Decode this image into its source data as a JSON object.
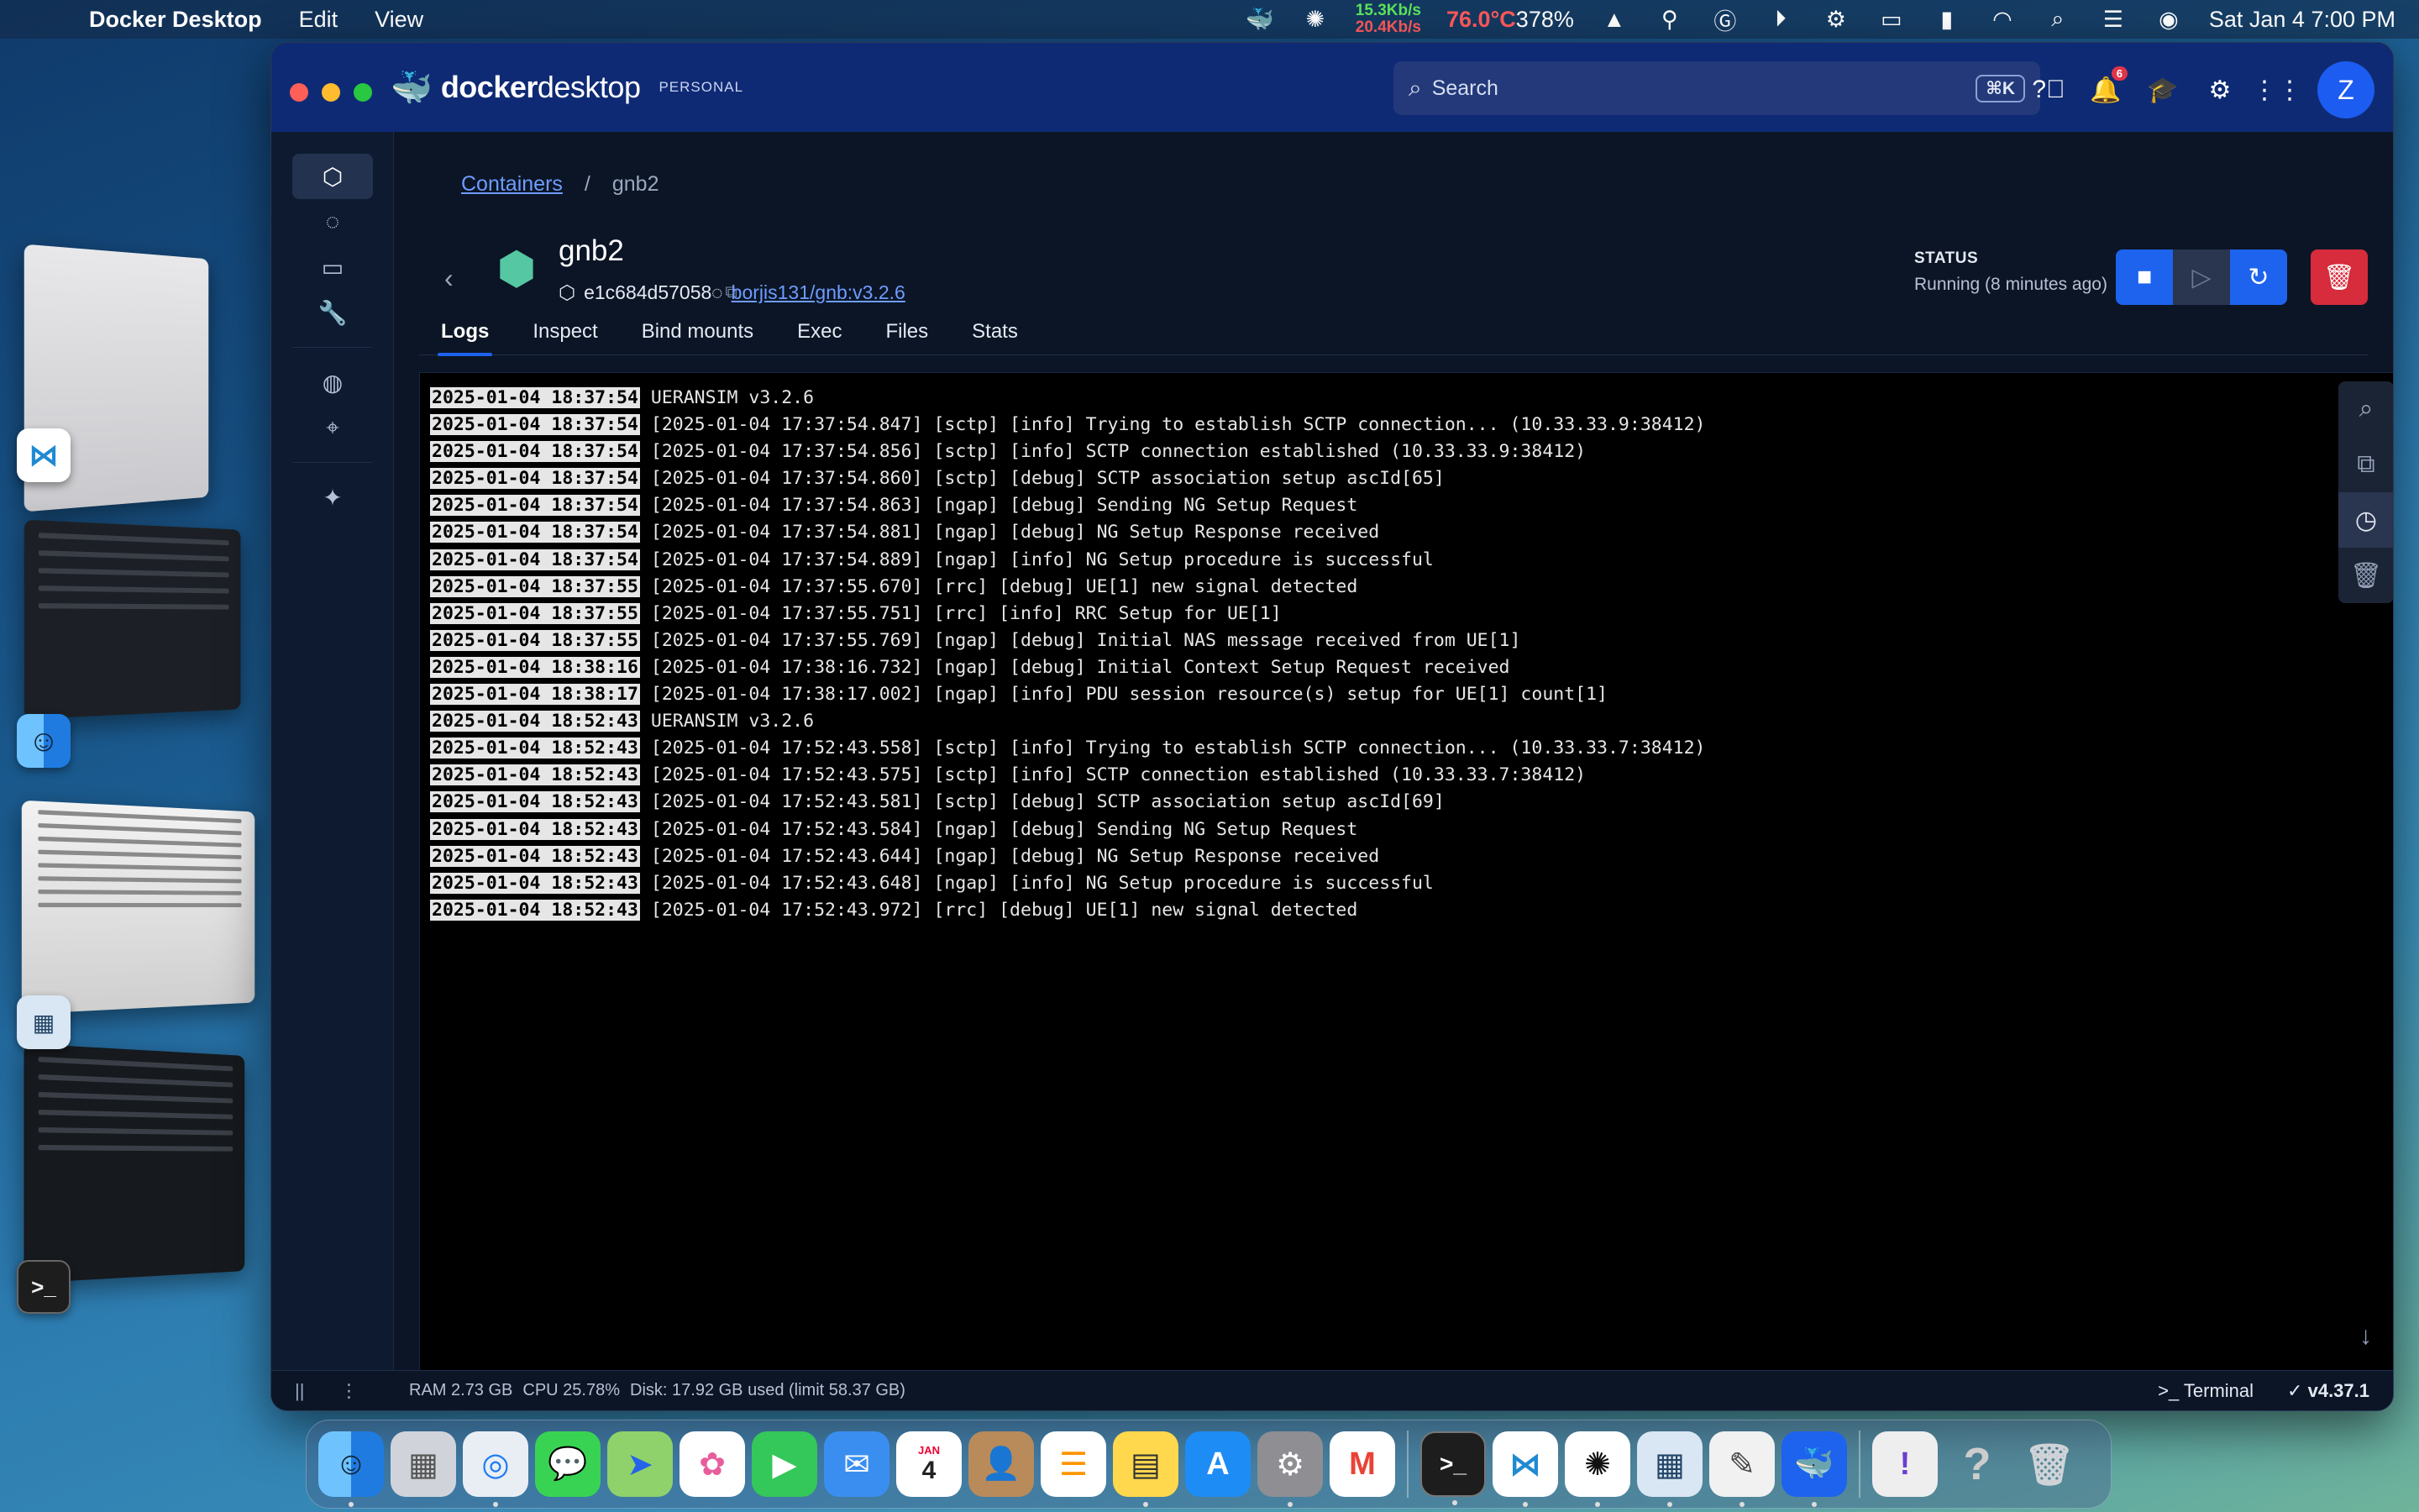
{
  "menubar": {
    "app_name": "Docker Desktop",
    "menus": [
      "Edit",
      "View"
    ],
    "net_up": "15.3Kb/s",
    "net_down": "20.4Kb/s",
    "temp": "76.0°C",
    "cpu": "378%",
    "datetime": "Sat Jan 4  7:00 PM"
  },
  "window": {
    "brand_docker": "docker",
    "brand_desktop": "desktop",
    "plan": "PERSONAL",
    "search_placeholder": "Search",
    "search_shortcut": "⌘K",
    "notification_count": "6",
    "avatar_initial": "Z"
  },
  "breadcrumb": {
    "root": "Containers",
    "separator": "/",
    "current": "gnb2"
  },
  "container": {
    "name": "gnb2",
    "id": "e1c684d57058",
    "image": "borjis131/gnb:v3.2.6",
    "status_label": "STATUS",
    "status_value": "Running (8 minutes ago)"
  },
  "tabs": [
    "Logs",
    "Inspect",
    "Bind mounts",
    "Exec",
    "Files",
    "Stats"
  ],
  "logs": [
    {
      "ts": "2025-01-04 18:37:54",
      "msg": "UERANSIM v3.2.6"
    },
    {
      "ts": "2025-01-04 18:37:54",
      "msg": "[2025-01-04 17:37:54.847] [sctp] [info] Trying to establish SCTP connection... (10.33.33.9:38412)"
    },
    {
      "ts": "2025-01-04 18:37:54",
      "msg": "[2025-01-04 17:37:54.856] [sctp] [info] SCTP connection established (10.33.33.9:38412)"
    },
    {
      "ts": "2025-01-04 18:37:54",
      "msg": "[2025-01-04 17:37:54.860] [sctp] [debug] SCTP association setup ascId[65]"
    },
    {
      "ts": "2025-01-04 18:37:54",
      "msg": "[2025-01-04 17:37:54.863] [ngap] [debug] Sending NG Setup Request"
    },
    {
      "ts": "2025-01-04 18:37:54",
      "msg": "[2025-01-04 17:37:54.881] [ngap] [debug] NG Setup Response received"
    },
    {
      "ts": "2025-01-04 18:37:54",
      "msg": "[2025-01-04 17:37:54.889] [ngap] [info] NG Setup procedure is successful"
    },
    {
      "ts": "2025-01-04 18:37:55",
      "msg": "[2025-01-04 17:37:55.670] [rrc] [debug] UE[1] new signal detected"
    },
    {
      "ts": "2025-01-04 18:37:55",
      "msg": "[2025-01-04 17:37:55.751] [rrc] [info] RRC Setup for UE[1]"
    },
    {
      "ts": "2025-01-04 18:37:55",
      "msg": "[2025-01-04 17:37:55.769] [ngap] [debug] Initial NAS message received from UE[1]"
    },
    {
      "ts": "2025-01-04 18:38:16",
      "msg": "[2025-01-04 17:38:16.732] [ngap] [debug] Initial Context Setup Request received"
    },
    {
      "ts": "2025-01-04 18:38:17",
      "msg": "[2025-01-04 17:38:17.002] [ngap] [info] PDU session resource(s) setup for UE[1] count[1]"
    },
    {
      "ts": "2025-01-04 18:52:43",
      "msg": "UERANSIM v3.2.6"
    },
    {
      "ts": "2025-01-04 18:52:43",
      "msg": "[2025-01-04 17:52:43.558] [sctp] [info] Trying to establish SCTP connection... (10.33.33.7:38412)"
    },
    {
      "ts": "2025-01-04 18:52:43",
      "msg": "[2025-01-04 17:52:43.575] [sctp] [info] SCTP connection established (10.33.33.7:38412)"
    },
    {
      "ts": "2025-01-04 18:52:43",
      "msg": "[2025-01-04 17:52:43.581] [sctp] [debug] SCTP association setup ascId[69]"
    },
    {
      "ts": "2025-01-04 18:52:43",
      "msg": "[2025-01-04 17:52:43.584] [ngap] [debug] Sending NG Setup Request"
    },
    {
      "ts": "2025-01-04 18:52:43",
      "msg": "[2025-01-04 17:52:43.644] [ngap] [debug] NG Setup Response received"
    },
    {
      "ts": "2025-01-04 18:52:43",
      "msg": "[2025-01-04 17:52:43.648] [ngap] [info] NG Setup procedure is successful"
    },
    {
      "ts": "2025-01-04 18:52:43",
      "msg": "[2025-01-04 17:52:43.972] [rrc] [debug] UE[1] new signal detected"
    }
  ],
  "statusbar": {
    "ram": "RAM 2.73 GB",
    "cpu": "CPU 25.78%",
    "disk": "Disk: 17.92 GB used (limit 58.37 GB)",
    "terminal": "Terminal",
    "version": "v4.37.1"
  },
  "dock": {
    "calendar_month": "JAN",
    "calendar_day": "4"
  },
  "colors": {
    "accent": "#1d63ed",
    "delete": "#d72c3b",
    "titlebar": "#0f2a74",
    "container_icon": "#55c7a3"
  }
}
